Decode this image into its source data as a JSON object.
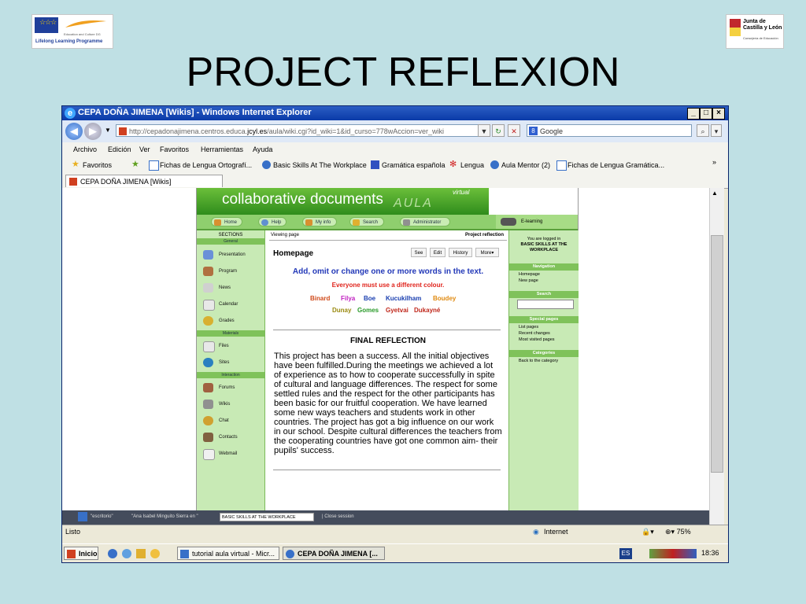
{
  "slide": {
    "title": "PROJECT REFLEXION",
    "eu_logo_text": "Education and Culture DG",
    "eu_programme": "Lifelong Learning Programme",
    "jcyl_name_1": "Junta de",
    "jcyl_name_2": "Castilla y León",
    "jcyl_sub": "Consejería de Educación"
  },
  "window": {
    "title": "CEPA DOÑA JIMENA [Wikis] - Windows Internet Explorer",
    "url_pre": "http://cepadonajimena.centros.educa.",
    "url_domain": "jcyl.es",
    "url_post": "/aula/wiki.cgi?id_wiki=1&id_curso=778wAccion=ver_wiki",
    "search_engine": "Google",
    "menu": [
      "Archivo",
      "Edición",
      "Ver",
      "Favoritos",
      "Herramientas",
      "Ayuda"
    ],
    "favorites_label": "Favoritos",
    "favorites": [
      "Fichas de Lengua Ortografí...",
      "Basic Skills At The Workplace",
      "Gramática española",
      "Lengua",
      "Aula Mentor (2)",
      "Fichas de Lengua Gramática..."
    ],
    "fav_more": "»",
    "tab_label": "CEPA DOÑA JIMENA [Wikis]"
  },
  "site": {
    "banner": "collaborative documents",
    "aula": "AULA",
    "virtual": "virtual",
    "topnav": [
      "Home",
      "Help",
      "My info",
      "Search",
      "Administrator"
    ],
    "elearning": "E-learning",
    "sidebar": {
      "sections_head": "SECTIONS",
      "general": "General",
      "items_general": [
        "Presentation",
        "Program",
        "News",
        "Calendar",
        "Grades"
      ],
      "materials": "Materials",
      "items_materials": [
        "Files",
        "Sites"
      ],
      "interaction": "Interaction",
      "items_interaction": [
        "Forums",
        "Wikis",
        "Chat",
        "Contacts",
        "Webmail"
      ]
    },
    "main": {
      "viewing": "Viewing page",
      "page_name": "Project reflection",
      "homepage": "Homepage",
      "tabs": [
        "See",
        "Edit",
        "History",
        "More"
      ],
      "instruction": "Add, omit or change one or more words in the text.",
      "subinstruction": "Everyone must use a different colour.",
      "names_row1": [
        "Binard",
        "Filya",
        "Boe",
        "Kucukilham",
        "Boudey"
      ],
      "names_row2": [
        "Dunay",
        "Gomes",
        "Gyetvai",
        "Dukayné"
      ],
      "final_title": "FINAL REFLECTION",
      "reflection": "This project has been a success. All the initial objectives have been fulfilled.During the meetings we achieved a lot of experience as to how to cooperate successfully in spite of cultural and language differences. The respect for some settled rules and the respect for the other participants has been basic for our fruitful cooperation. We have learned some new ways teachers and students work in other countries. The project has got a big influence on our work in our school. Despite cultural differences the teachers from the cooperating countries have got one common aim- their pupils' success."
    },
    "right": {
      "logged_1": "You are logged in",
      "logged_2": "BASIC SKILLS AT THE",
      "logged_3": "WORKPLACE",
      "navigation": "Navigation",
      "nav_links": [
        "Homepage",
        "New page"
      ],
      "search": "Search",
      "special": "Special pages",
      "special_links": [
        "List pages",
        "Recent changes",
        "Most visited pages"
      ],
      "categories": "Categories",
      "cat_links": [
        "Back to the category"
      ]
    },
    "bottom": {
      "desk": "\"escritorio\"",
      "user": "\"Ana Isabel Minguito Sierra en \"",
      "course": "BASIC SKILLS AT THE WORKPLACE",
      "close": "| Close session"
    }
  },
  "status": {
    "text": "Listo",
    "zone": "Internet",
    "zoom": "75%"
  },
  "taskbar": {
    "start": "Inicio",
    "items": [
      "tutorial aula virtual - Micr...",
      "CEPA DOÑA JIMENA [..."
    ],
    "lang": "ES",
    "time": "18:36"
  },
  "colors": {
    "names_row1": [
      "#d04a1a",
      "#c020c0",
      "#1a3fb0",
      "#1a3fb0",
      "#e08a10"
    ],
    "names_row2": [
      "#9a8a10",
      "#2a9a2a",
      "#c0281c",
      "#c0281c"
    ]
  }
}
